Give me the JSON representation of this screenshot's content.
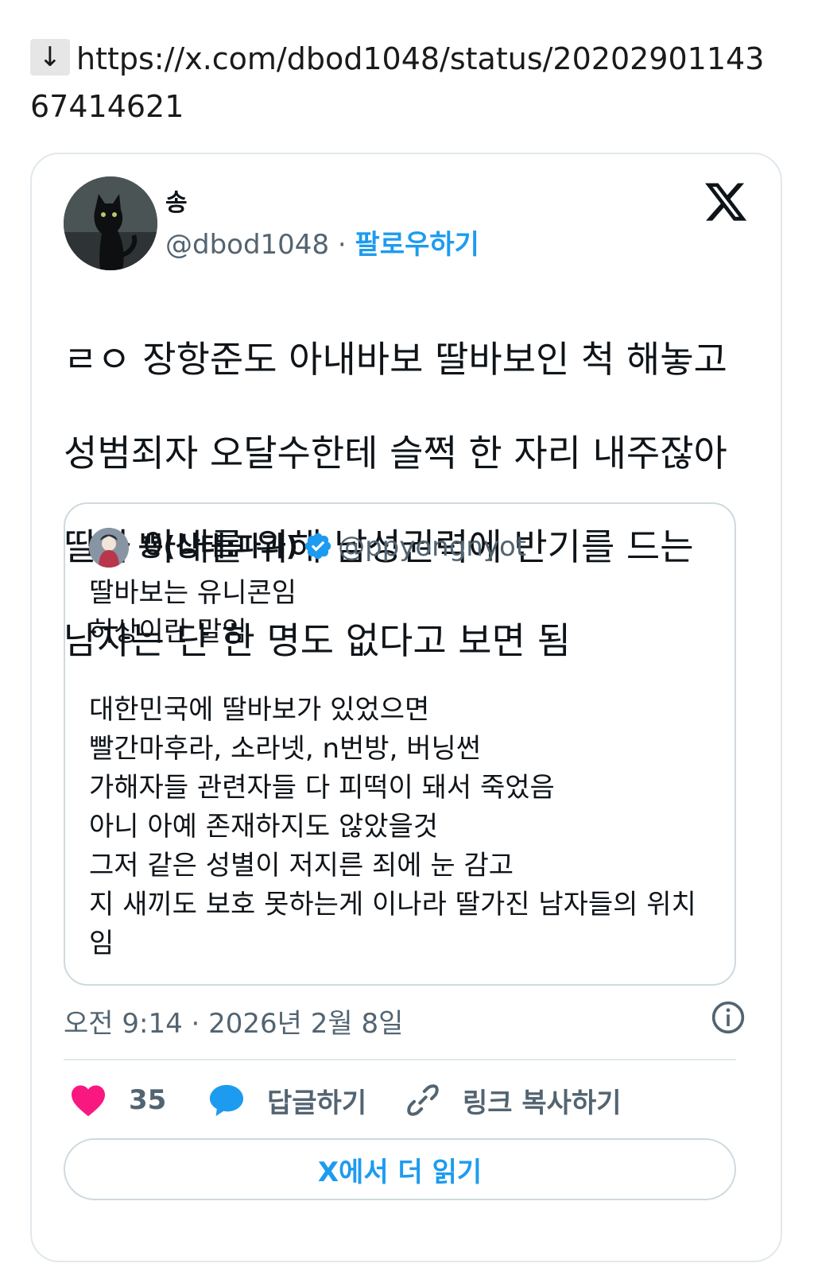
{
  "url": {
    "arrow": "↓",
    "text": "https://x.com/dbod1048/status/2020290114367414621"
  },
  "tweet": {
    "author_name": "송",
    "handle": "@dbod1048",
    "separator": "·",
    "follow_label": "팔로우하기",
    "lines": [
      "ㄹㅇ 장항준도 아내바보 딸바보인 척 해놓고",
      "성범죄자 오달수한테 슬쩍 한 자리 내주잖아",
      "딸과 아내를 위해 남성권력에 반기를 드는",
      "남자는 단 한 명도 없다고 보면 됨"
    ],
    "timestamp": "오전 9:14 · 2026년 2월 8일"
  },
  "quote": {
    "author_name": "뿅(상태:파과)",
    "handle": "@ppyongnyot",
    "lines": [
      "딸바보는 유니콘임",
      "허상이란 말임",
      "",
      "대한민국에 딸바보가 있었으면",
      "빨간마후라, 소라넷, n번방, 버닝썬",
      "가해자들 관련자들 다 피떡이 돼서 죽었음",
      "아니 아예 존재하지도 않았을것",
      "그저 같은 성별이 저지른 죄에 눈 감고",
      "지 새끼도 보호 못하는게 이나라 딸가진 남자들의 위치",
      "임"
    ]
  },
  "actions": {
    "like_count": "35",
    "reply_label": "답글하기",
    "copy_link_label": "링크 복사하기"
  },
  "read_more_label": "X에서 더 읽기",
  "icons": {
    "like": "heart-icon",
    "reply": "speech-bubble-icon",
    "copy": "link-icon",
    "info": "info-icon",
    "logo": "x-logo-icon",
    "verified": "verified-badge-icon"
  },
  "colors": {
    "heart": "#f91880",
    "accent": "#1d9bf0",
    "muted": "#536471",
    "border": "#cfd9de"
  }
}
